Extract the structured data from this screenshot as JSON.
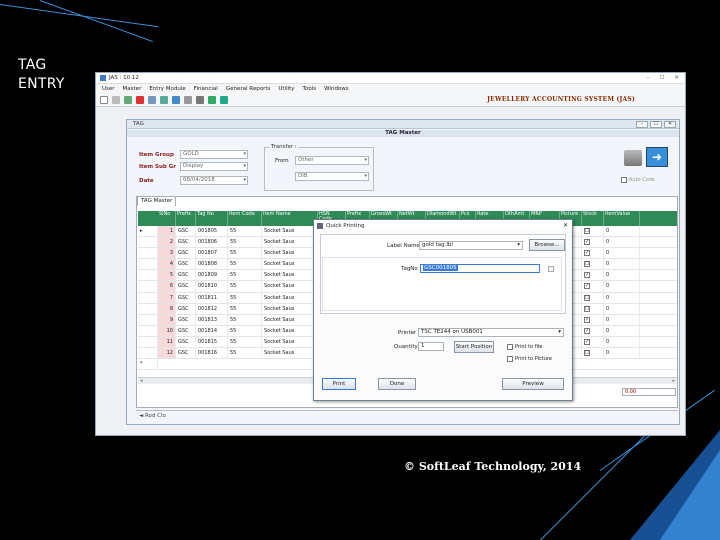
{
  "slide": {
    "title_line1": "TAG",
    "title_line2": "ENTRY",
    "footer": "© SoftLeaf Technology, 2014"
  },
  "app": {
    "title": "JAS : 10.12",
    "menu": [
      "User",
      "Master",
      "Entry Module",
      "Financial",
      "General Reports",
      "Utility",
      "Tools",
      "Windows"
    ],
    "app_name": "JEWELLERY ACCOUNTING SYSTEM (JAS)",
    "window_controls": [
      "–",
      "☐",
      "✕"
    ]
  },
  "tag_window": {
    "title": "TAG",
    "header": "TAG Master",
    "item_group_label": "Item Group",
    "item_group_value": "GOLD",
    "item_sub_label": "Item Sub Gr",
    "item_sub_value": "Display",
    "date_label": "Date",
    "date_value": "08/04/2018",
    "transfer_label": "Transfer :",
    "from_label": "From",
    "from_value": "Other",
    "to_value": "DIB",
    "autocode_label": "Auto Code",
    "tab_label": "TAG Master",
    "columns": [
      "SlNo",
      "Prefix",
      "Tag No",
      "Item Code",
      "Item Name",
      "HSN Code",
      "Prefix",
      "GrossWt",
      "NetWt",
      "DiamondWt",
      "Pcs",
      "Rate",
      "OthAmt",
      "MRP",
      "Picture",
      "Stock",
      "ItemValue"
    ],
    "rows": [
      {
        "slno": "1",
        "prefix": "GSC",
        "tagno": "001805",
        "code": "55",
        "name": "Socket Saus",
        "stock": "☐",
        "value": "0"
      },
      {
        "slno": "2",
        "prefix": "GSC",
        "tagno": "001806",
        "code": "55",
        "name": "Socket Saus",
        "stock": "✓",
        "value": "0"
      },
      {
        "slno": "3",
        "prefix": "GSC",
        "tagno": "001807",
        "code": "55",
        "name": "Socket Saus",
        "stock": "✓",
        "value": "0"
      },
      {
        "slno": "4",
        "prefix": "GSC",
        "tagno": "001808",
        "code": "55",
        "name": "Socket Saus",
        "stock": "☐",
        "value": "0"
      },
      {
        "slno": "5",
        "prefix": "GSC",
        "tagno": "001809",
        "code": "55",
        "name": "Socket Saus",
        "stock": "✓",
        "value": "0"
      },
      {
        "slno": "6",
        "prefix": "GSC",
        "tagno": "001810",
        "code": "55",
        "name": "Socket Saus",
        "stock": "✓",
        "value": "0"
      },
      {
        "slno": "7",
        "prefix": "GSC",
        "tagno": "001811",
        "code": "55",
        "name": "Socket Saus",
        "stock": "☐",
        "value": "0"
      },
      {
        "slno": "8",
        "prefix": "GSC",
        "tagno": "001812",
        "code": "55",
        "name": "Socket Saus",
        "stock": "☐",
        "value": "0"
      },
      {
        "slno": "9",
        "prefix": "GSC",
        "tagno": "001813",
        "code": "55",
        "name": "Socket Saus",
        "stock": "✓",
        "value": "0"
      },
      {
        "slno": "10",
        "prefix": "GSC",
        "tagno": "001814",
        "code": "55",
        "name": "Socket Saus",
        "stock": "✓",
        "value": "0"
      },
      {
        "slno": "11",
        "prefix": "GSC",
        "tagno": "001815",
        "code": "55",
        "name": "Socket Saus",
        "stock": "✓",
        "value": "0"
      },
      {
        "slno": "12",
        "prefix": "GSC",
        "tagno": "001816",
        "code": "55",
        "name": "Socket Saus",
        "stock": "☐",
        "value": "0"
      }
    ],
    "total_value": "0.00",
    "status_text": "◄ Rod Clo"
  },
  "dialog": {
    "title": "Quick Printing",
    "label_name_label": "Label Name",
    "label_name_value": "gold tag.lbl",
    "browse_label": "Browse...",
    "tagno_label": "TagNo",
    "tagno_value": "GSC001805",
    "printer_label": "Printer",
    "printer_value": "TSC TE244 on USB001",
    "quantity_label": "Quantity",
    "quantity_value": "1",
    "start_position_label": "Start Position",
    "print_to_file_label": "Print to file",
    "print_to_picture_label": "Print to Picture",
    "print_button": "Print",
    "done_button": "Done",
    "preview_button": "Preview"
  },
  "colors": {
    "grid_header": "#2e8b57",
    "label_red": "#8a1c1c",
    "app_name": "#8a2c00",
    "accent_blue": "#3a8fd9"
  }
}
